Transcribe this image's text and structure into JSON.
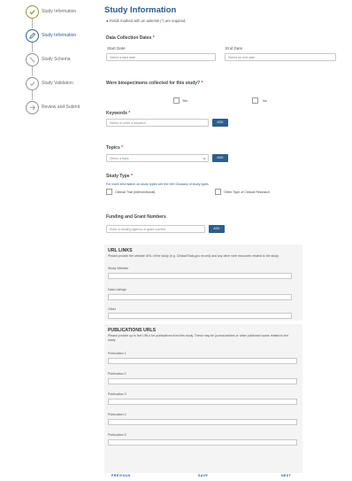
{
  "stepper": {
    "steps": [
      {
        "label": "Study Information",
        "state": "done"
      },
      {
        "label": "Study Information",
        "state": "current"
      },
      {
        "label": "Study Schema",
        "state": "todo"
      },
      {
        "label": "Study Validation",
        "state": "todo"
      },
      {
        "label": "Review and Submit",
        "state": "todo"
      }
    ]
  },
  "page": {
    "title": "Study Information",
    "required_note_prefix": "Fields marked with an asterisk (",
    "required_note_star": "*",
    "required_note_suffix": ") are required."
  },
  "data_collection": {
    "label": "Data Collection Dates",
    "star": "*",
    "start_label": "Start Date",
    "end_label": "End Date",
    "start_placeholder": "Select a start date",
    "end_placeholder": "Select an end date"
  },
  "biospecimens": {
    "question": "Were biospecimens collected for this study?",
    "star": "*",
    "yes_label": "Yes",
    "no_label": "No"
  },
  "keywords": {
    "label": "Keywords",
    "star": "*",
    "placeholder": "Select or enter a keyword",
    "add_label": "ADD"
  },
  "topics": {
    "label": "Topics",
    "star": "*",
    "placeholder": "Select a topic",
    "add_label": "ADD"
  },
  "study_type": {
    "label": "Study Type",
    "star": "*",
    "note": "For more information on study types see the NIH Glossary of study types",
    "option_clinical": "Clinical Trial (interventional)",
    "option_observational": "Other Type of Clinical Research"
  },
  "funding": {
    "label": "Funding and Grant Numbers",
    "placeholder": "Enter a funding agency or grant number",
    "add_label": "ADD"
  },
  "url_links": {
    "title": "URL LINKS",
    "description": "Please provide the website URL of the study (e.g. ClinicalTrials.gov record) and any other web resources related to the study.",
    "fields": [
      "Study Website",
      "Data Listings",
      "Other"
    ]
  },
  "publications": {
    "title": "PUBLICATIONS URLS",
    "description": "Please provide up to five URLs for publications from this study. These may be journal articles or other published works related to the study.",
    "fields": [
      "Publication 1",
      "Publication 2",
      "Publication 3",
      "Publication 4",
      "Publication 5"
    ]
  },
  "footer": {
    "previous": "PREVIOUS",
    "save": "SAVE",
    "next": "NEXT"
  },
  "colors": {
    "brand_blue": "#2a5b8c",
    "button_blue": "#2d5e8a",
    "required_red": "#c0392b",
    "done_green": "#8a9a3a"
  }
}
